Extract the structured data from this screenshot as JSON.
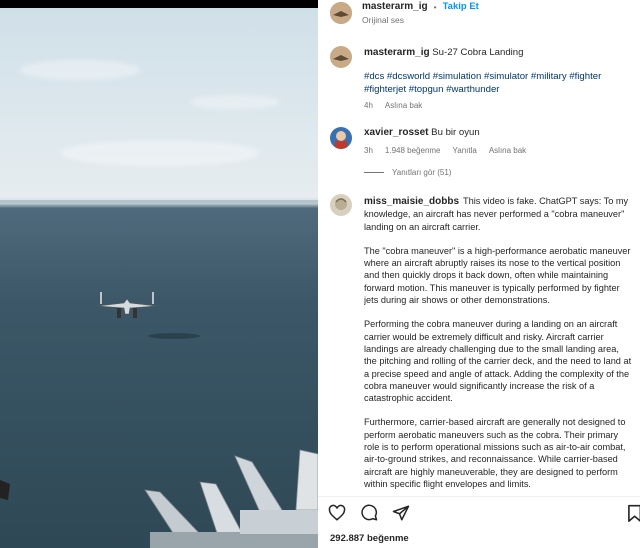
{
  "post": {
    "author": "masterarm_ig",
    "follow_label": "Takip Et",
    "audio": "Orijinal ses",
    "caption_title": "Su-27 Cobra Landing",
    "hashtags": "#dcs #dcsworld #simulation #simulator #military #fighter #fighterjet #topgun #warthunder",
    "caption_time": "4h",
    "caption_translate": "Aslına bak"
  },
  "comments": [
    {
      "user": "xavier_rosset",
      "text": "Bu bir oyun",
      "time": "3h",
      "likes": "1.948 beğenme",
      "reply": "Yanıtla",
      "translate": "Aslına bak",
      "view_replies": "Yanıtları gör (51)"
    },
    {
      "user": "miss_maisie_dobbs",
      "paragraphs": [
        "This video is fake. ChatGPT says: To my knowledge, an aircraft has never performed a \"cobra maneuver\" landing on an aircraft carrier.",
        "The \"cobra maneuver\" is a high-performance aerobatic maneuver where an aircraft abruptly raises its nose to the vertical position and then quickly drops it back down, often while maintaining forward motion. This maneuver is typically performed by fighter jets during air shows or other demonstrations.",
        "Performing the cobra maneuver during a landing on an aircraft carrier would be extremely difficult and risky. Aircraft carrier landings are already challenging due to the small landing area, the pitching and rolling of the carrier deck, and the need to land at a precise speed and angle of attack. Adding the complexity of the cobra maneuver would significantly increase the risk of a catastrophic accident.",
        "Furthermore, carrier-based aircraft are generally not designed to perform aerobatic maneuvers such as the cobra. Their primary role is to perform operational missions such as air-to-air combat, air-to-ground strikes, and reconnaissance. While carrier-based aircraft are highly maneuverable, they are designed to perform within specific flight envelopes and limits."
      ]
    }
  ],
  "footer": {
    "likes": "292.887 beğenme"
  },
  "icons": [
    "heart-icon",
    "comment-icon",
    "share-icon",
    "bookmark-icon"
  ]
}
